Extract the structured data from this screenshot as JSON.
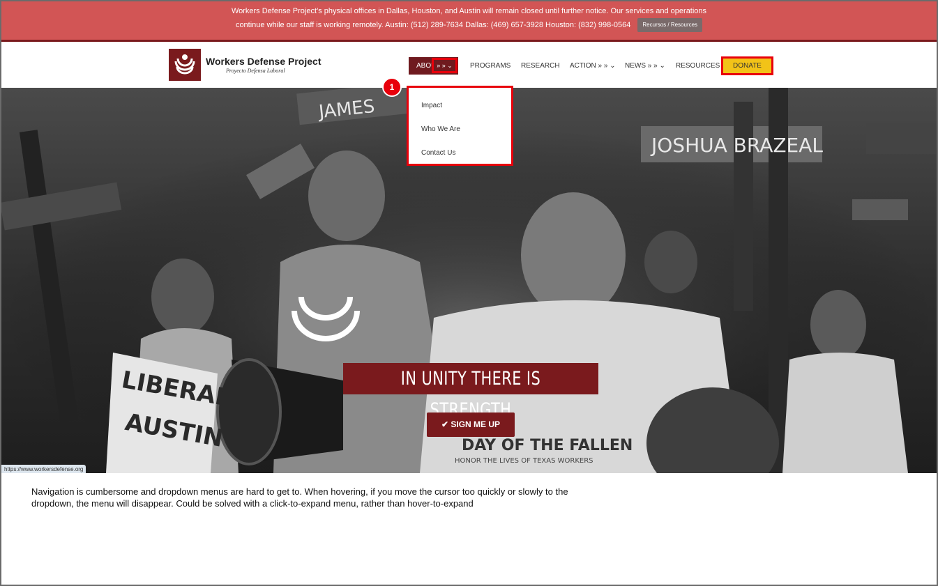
{
  "notice": {
    "line1": "Workers Defense Project’s physical offices in Dallas, Houston, and Austin will remain closed until further notice. Our services and operations",
    "line2": "continue while our staff is working remotely. Austin: (512) 289-7634 Dallas: (469) 657-3928 Houston: (832) 998-0564",
    "button_label": "Recursos / Resources",
    "color": "#d25555"
  },
  "header": {
    "logo_title": "Workers Defense Project",
    "logo_subtitle": "Proyecto Defensa Laboral",
    "brand_color": "#7a1a1d"
  },
  "nav": {
    "about_label": "ABOU",
    "about_arrows": "» » ⌄",
    "items": [
      {
        "label": "PROGRAMS"
      },
      {
        "label": "RESEARCH"
      },
      {
        "label": "ACTION » » ⌄"
      },
      {
        "label": "NEWS » » ⌄"
      },
      {
        "label": "RESOURCES"
      }
    ],
    "donate_label": "DONATE",
    "donate_color": "#f2c318"
  },
  "dropdown": {
    "items": [
      {
        "label": "Impact"
      },
      {
        "label": "Who We Are"
      },
      {
        "label": "Contact Us"
      }
    ],
    "annotation_number": "1",
    "highlight_color": "#e8000b"
  },
  "hero": {
    "headline": "IN UNITY THERE IS STRENGTH",
    "cta_label": "SIGN ME UP",
    "cta_icon": "check-icon",
    "status_url": "https://www.workersdefense.org",
    "photo_text": {
      "sign1": "JAMES",
      "sign2": "JOSHUA BRAZEAL",
      "sign3": "LIBERAL",
      "sign4": "AUSTIN",
      "shirt": "DAY OF THE FALLEN",
      "shirt_sub": "HONOR THE LIVES OF TEXAS WORKERS"
    }
  },
  "caption": {
    "text": "Navigation is cumbersome and dropdown menus are hard to get to. When hovering, if you move the cursor too quickly or slowly to the dropdown, the menu will disappear. Could be solved with a click-to-expand menu, rather than hover-to-expand"
  }
}
